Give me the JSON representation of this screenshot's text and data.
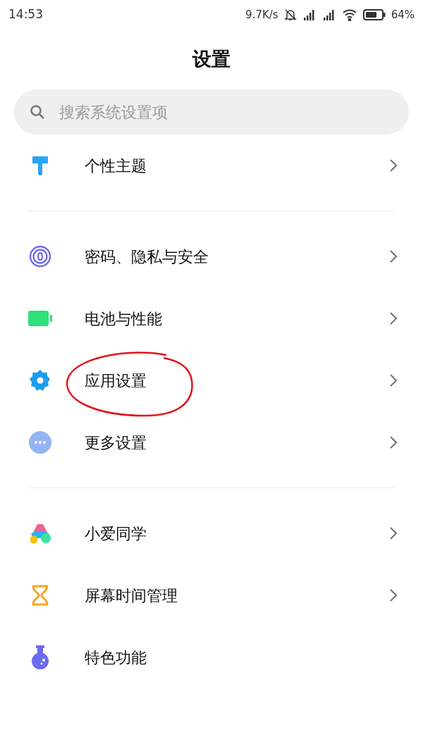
{
  "status_bar": {
    "time": "14:53",
    "speed": "9.7K/s",
    "battery_text": "64%"
  },
  "title": "设置",
  "search": {
    "placeholder": "搜索系统设置项"
  },
  "groups": [
    {
      "items": [
        {
          "kind": "brush",
          "label": "个性主题",
          "chevron": true,
          "circled": false
        }
      ]
    },
    {
      "items": [
        {
          "kind": "fingerprint",
          "label": "密码、隐私与安全",
          "chevron": true,
          "circled": false
        },
        {
          "kind": "battery",
          "label": "电池与性能",
          "chevron": true,
          "circled": false
        },
        {
          "kind": "gear",
          "label": "应用设置",
          "chevron": true,
          "circled": true
        },
        {
          "kind": "dots",
          "label": "更多设置",
          "chevron": true,
          "circled": false
        }
      ]
    },
    {
      "items": [
        {
          "kind": "assistant",
          "label": "小爱同学",
          "chevron": true,
          "circled": false
        },
        {
          "kind": "hourglass",
          "label": "屏幕时间管理",
          "chevron": true,
          "circled": false
        },
        {
          "kind": "flask",
          "label": "特色功能",
          "chevron": false,
          "circled": false
        }
      ]
    }
  ]
}
